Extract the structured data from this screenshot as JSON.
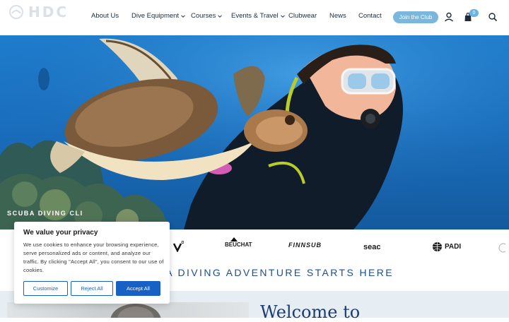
{
  "header": {
    "logo_text": "HDC",
    "nav": [
      {
        "label": "About Us",
        "dropdown": false
      },
      {
        "label": "Dive Equipment",
        "dropdown": true
      },
      {
        "label": "Courses",
        "dropdown": true
      },
      {
        "label": "Events & Travel",
        "dropdown": true
      },
      {
        "label": "Clubwear",
        "dropdown": false
      },
      {
        "label": "News",
        "dropdown": false
      },
      {
        "label": "Contact",
        "dropdown": false
      }
    ],
    "join_label": "Join the Club",
    "cart_count": "0",
    "icons": [
      "user-icon",
      "cart-icon",
      "search-icon"
    ]
  },
  "hero": {
    "caption": "SCUBA DIVING CLI"
  },
  "brands": [
    "BEUCHAT",
    "FINNSUB",
    "seac",
    "PADI"
  ],
  "tagline": "UBA DIVING ADVENTURE STARTS HERE",
  "welcome": "Welcome to",
  "cookie": {
    "title": "We value your privacy",
    "body": "We use cookies to enhance your browsing experience, serve personalized ads or content, and analyze our traffic. By clicking \"Accept All\", you consent to our use of cookies.",
    "customize": "Customize",
    "reject": "Reject All",
    "accept": "Accept All"
  },
  "colors": {
    "accent": "#1861c4",
    "join_button": "#7bb6dd",
    "heading": "#1d4f8c"
  }
}
